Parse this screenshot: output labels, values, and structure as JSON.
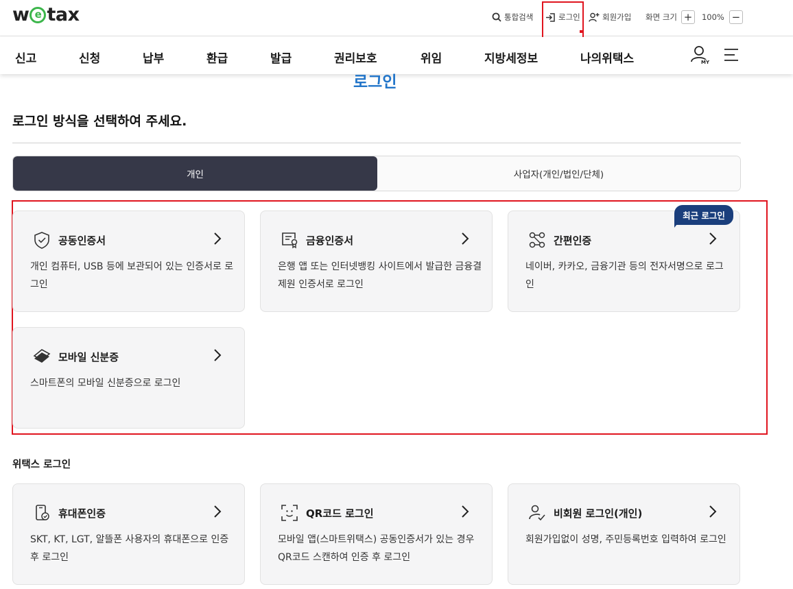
{
  "header": {
    "logo_prefix": "w",
    "logo_e": "e",
    "logo_suffix": "tax",
    "search_label": "통합검색",
    "login_label": "로그인",
    "signup_label": "회원가입",
    "font_size_label": "화면 크기",
    "zoom_in": "+",
    "zoom_level": "100%",
    "zoom_out": "−"
  },
  "nav": {
    "items": [
      "신고",
      "신청",
      "납부",
      "환급",
      "발급",
      "권리보호",
      "위임",
      "지방세정보",
      "나의위택스"
    ],
    "my_label": "MY"
  },
  "page": {
    "title": "로그인",
    "subtitle": "로그인 방식을 선택하여 주세요."
  },
  "tabs": {
    "individual": "개인",
    "business": "사업자(개인/법인/단체)"
  },
  "badge": "최근 로그인",
  "cards": [
    {
      "icon": "shield-check-icon",
      "title": "공동인증서",
      "desc": "개인 컴퓨터, USB 등에 보관되어 있는 인증서로 로그인"
    },
    {
      "icon": "certificate-icon",
      "title": "금융인증서",
      "desc": "은행 앱 또는 인터넷뱅킹 사이트에서 발급한 금융결제원 인증서로 로그인"
    },
    {
      "icon": "nodes-icon",
      "title": "간편인증",
      "desc": "네이버, 카카오, 금융기관 등의 전자서명으로 로그인"
    },
    {
      "icon": "mobile-id-icon",
      "title": "모바일 신분증",
      "desc": "스마트폰의 모바일 신분증으로 로그인"
    }
  ],
  "wetax_section": {
    "label": "위택스 로그인",
    "cards": [
      {
        "icon": "phone-cert-icon",
        "title": "휴대폰인증",
        "desc": "SKT, KT, LGT, 알뜰폰 사용자의 휴대폰으로 인증 후 로그인"
      },
      {
        "icon": "qr-face-icon",
        "title": "QR코드 로그인",
        "desc": "모바일 앱(스마트위택스) 공동인증서가 있는 경우 QR코드 스캔하여 인증 후 로그인"
      },
      {
        "icon": "user-check-icon",
        "title": "비회원 로그인(개인)",
        "desc": "회원가입없이 성명, 주민등록번호 입력하여 로그인"
      }
    ]
  },
  "colors": {
    "accent_blue": "#2275c9",
    "active_tab": "#363848",
    "badge": "#1a3e7c",
    "highlight_red": "#e0141e",
    "logo_green": "#3cb64b"
  }
}
